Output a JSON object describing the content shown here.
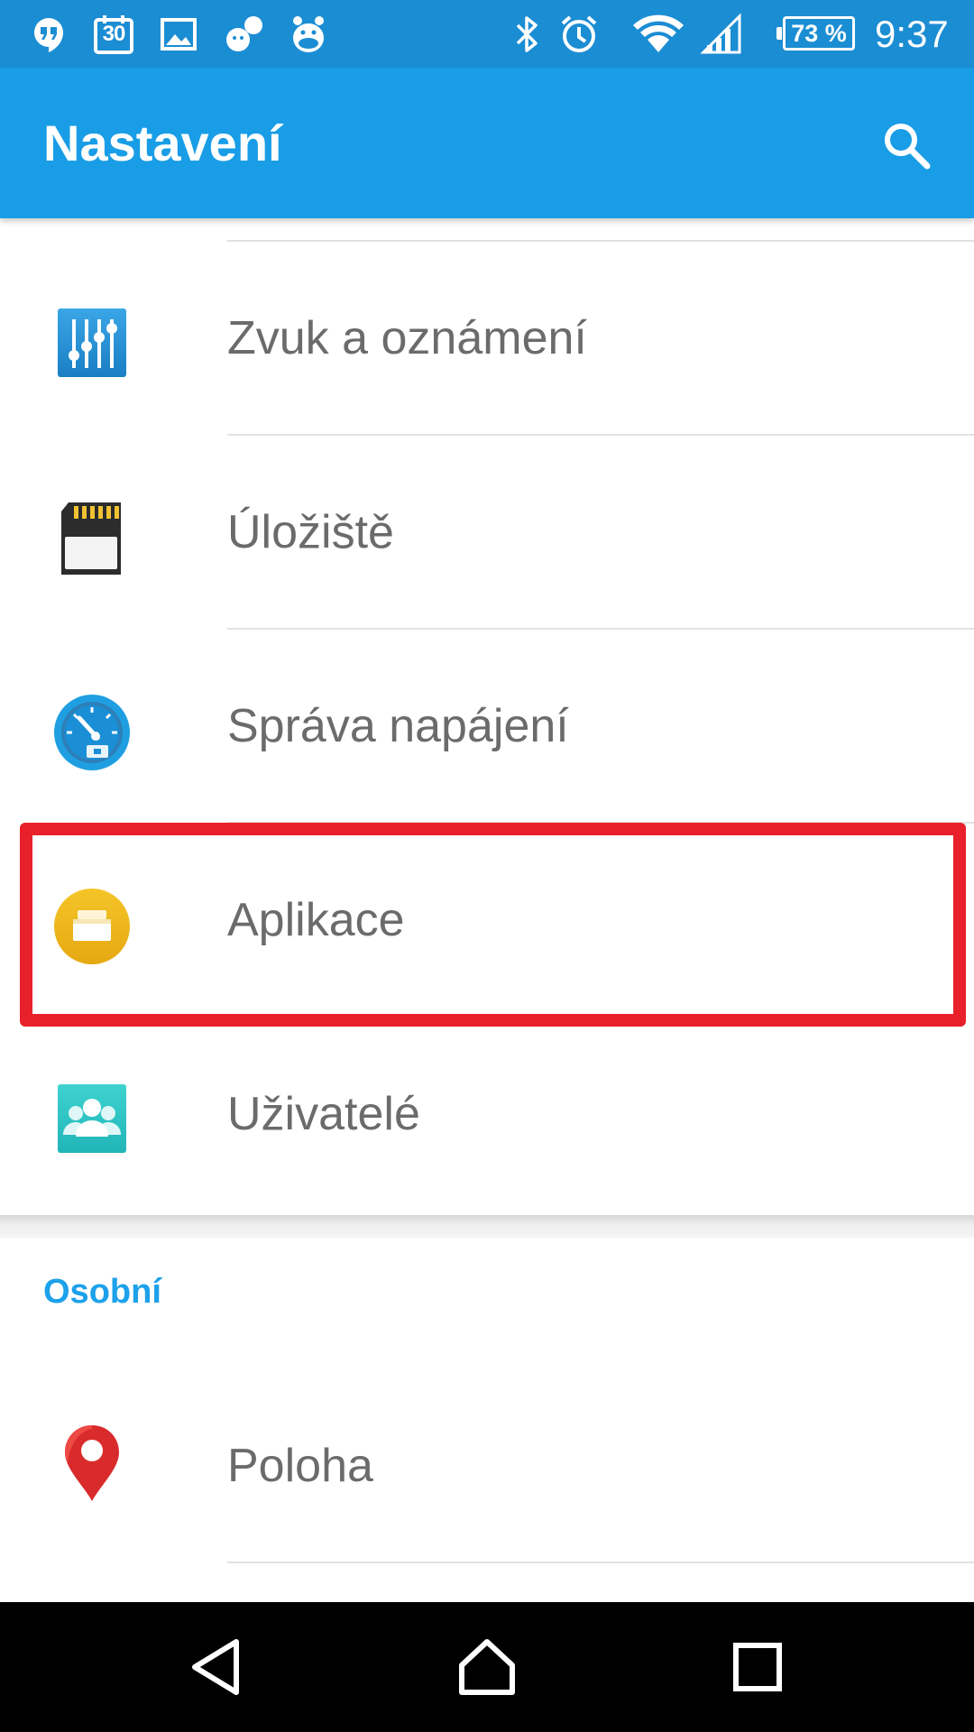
{
  "status_bar": {
    "calendar_day": "30",
    "battery_text": "73 %",
    "time": "9:37",
    "icons": [
      "hangouts-icon",
      "calendar-icon",
      "gallery-icon",
      "chat-icon",
      "hippo-icon",
      "bluetooth-icon",
      "alarm-icon",
      "wifi-icon",
      "signal-icon",
      "battery-icon"
    ]
  },
  "app_bar": {
    "title": "Nastavení",
    "search_icon": "search-icon"
  },
  "settings_items": [
    {
      "label": "Zvuk a oznámení",
      "icon": "sound-equalizer-icon"
    },
    {
      "label": "Úložiště",
      "icon": "sd-card-icon"
    },
    {
      "label": "Správa napájení",
      "icon": "power-gauge-icon"
    },
    {
      "label": "Aplikace",
      "icon": "apps-icon"
    },
    {
      "label": "Uživatelé",
      "icon": "users-icon"
    }
  ],
  "section_personal": {
    "header": "Osobní",
    "items": [
      {
        "label": "Poloha",
        "icon": "location-pin-icon"
      }
    ]
  },
  "colors": {
    "status_bar": "#1b8dd3",
    "app_bar": "#199de6",
    "section_header": "#1da1ea",
    "highlight_border": "#e8202a",
    "label_text": "#6b6b6b"
  },
  "nav_bar": [
    "back-icon",
    "home-icon",
    "recents-icon"
  ]
}
